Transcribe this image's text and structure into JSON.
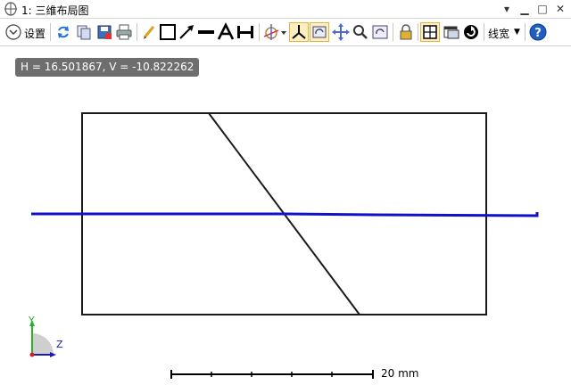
{
  "window": {
    "title": "1: 三维布局图",
    "icon": "lens-layout-icon"
  },
  "toolbar": {
    "settings_label": "设置",
    "linewidth_label": "线宽",
    "icons": [
      "refresh-icon",
      "copy-icon",
      "save-icon",
      "print-icon",
      "pencil-icon",
      "rectangle-icon",
      "arrow-icon",
      "line-icon",
      "text-icon",
      "dimension-icon",
      "rotate-view-icon",
      "axes-icon",
      "pan-icon",
      "move-icon",
      "zoom-icon",
      "reset-zoom-icon",
      "lock-icon",
      "fit-icon",
      "window-icon",
      "cycle-icon",
      "help-icon"
    ]
  },
  "canvas": {
    "readout": "H = 16.501867, V = -10.822262",
    "scale_label": "20 mm",
    "axis_y_label": "Y",
    "axis_z_label": "Z",
    "colors": {
      "element": "#1a1a1a",
      "ray": "#1010c8"
    }
  }
}
